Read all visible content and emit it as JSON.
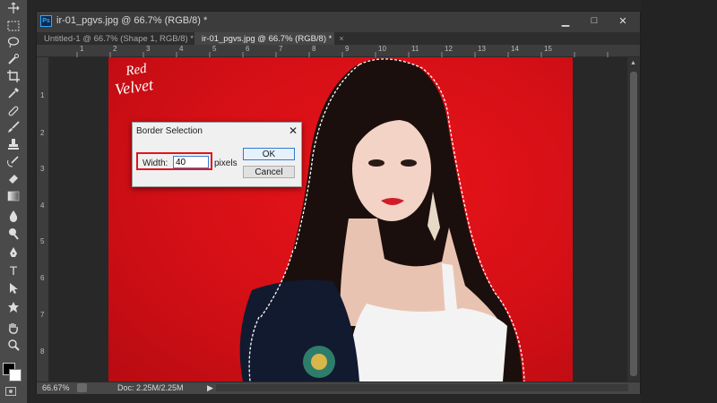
{
  "app": {
    "window_title": "ir-01_pgvs.jpg @ 66.7% (RGB/8) *",
    "ps_icon": "Ps"
  },
  "tabs": [
    {
      "label": "Untitled-1 @ 66.7% (Shape 1, RGB/8) *",
      "close": "×",
      "active": false
    },
    {
      "label": "ir-01_pgvs.jpg @ 66.7% (RGB/8) *",
      "close": "×",
      "active": true
    }
  ],
  "window_controls": {
    "minimize": "▁",
    "maximize": "□",
    "close": "✕"
  },
  "ruler": {
    "top": [
      "1",
      "2",
      "3",
      "4",
      "5",
      "6",
      "7",
      "8",
      "9",
      "10",
      "11",
      "12",
      "13",
      "14",
      "15"
    ],
    "left": [
      "1",
      "2",
      "3",
      "4",
      "5",
      "6",
      "7",
      "8"
    ]
  },
  "status": {
    "zoom": "66.67%",
    "doc": "Doc: 2.25M/2.25M",
    "arrow": "▶"
  },
  "image": {
    "logo_text": "Red Velvet"
  },
  "dialog": {
    "title": "Border Selection",
    "close": "✕",
    "width_label": "Width:",
    "width_value": "40",
    "unit_label": "pixels",
    "ok_label": "OK",
    "cancel_label": "Cancel"
  },
  "tools": [
    "move-tool-icon",
    "marquee-tool-icon",
    "lasso-tool-icon",
    "quick-selection-tool-icon",
    "crop-tool-icon",
    "eyedropper-tool-icon",
    "healing-brush-tool-icon",
    "brush-tool-icon",
    "clone-stamp-tool-icon",
    "history-brush-tool-icon",
    "eraser-tool-icon",
    "gradient-tool-icon",
    "blur-tool-icon",
    "dodge-tool-icon",
    "pen-tool-icon",
    "type-tool-icon",
    "path-selection-tool-icon",
    "shape-tool-icon",
    "hand-tool-icon",
    "zoom-tool-icon"
  ],
  "colors": {
    "accent_blue": "#31a8ff",
    "highlight_red": "#e0161d",
    "foreground": "#000000",
    "background": "#ffffff"
  }
}
